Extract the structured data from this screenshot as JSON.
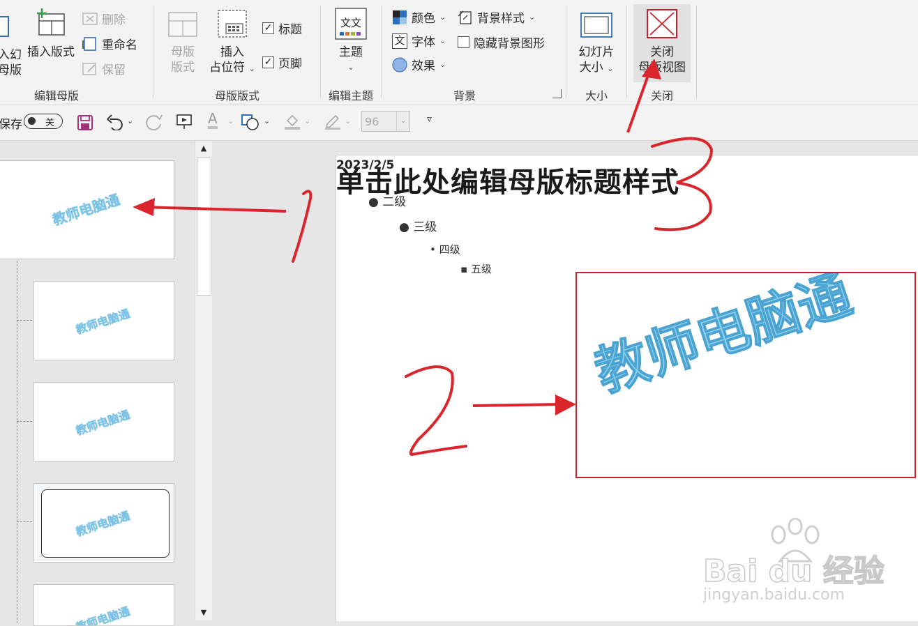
{
  "ribbon": {
    "edit_master": {
      "insert_slide_master_partial": [
        "入幻",
        "母版"
      ],
      "insert_layout": "插入版式",
      "delete": "删除",
      "rename": "重命名",
      "preserve": "保留",
      "group_label": "编辑母版"
    },
    "master_layout": {
      "master_layout_button": [
        "母版",
        "版式"
      ],
      "insert_placeholder": [
        "插入",
        "占位符"
      ],
      "title_checkbox": "标题",
      "footer_checkbox": "页脚",
      "group_label": "母版版式"
    },
    "edit_theme": {
      "themes": "主题",
      "theme_icon_text": "文文",
      "group_label": "编辑主题"
    },
    "background": {
      "colors": "颜色",
      "fonts": "字体",
      "font_icon_text": "文",
      "effects": "效果",
      "background_styles": "背景样式",
      "hide_background_graphics": "隐藏背景图形",
      "group_label": "背景"
    },
    "size": {
      "slide_size": [
        "幻灯片",
        "大小"
      ],
      "group_label": "大小"
    },
    "close": {
      "close_master_view": [
        "关闭",
        "母版视图"
      ],
      "group_label": "关闭"
    }
  },
  "qat": {
    "autosave_label": "保存",
    "autosave_state": "关",
    "font_size_value": "96"
  },
  "thumbnails": {
    "watermark": "教师电脑通"
  },
  "slide": {
    "date_overlap": "2023/2/5",
    "title": "单击此处编辑母版标题样式",
    "levels": [
      "二级",
      "三级",
      "四级",
      "五级"
    ],
    "watermark": "教师电脑通"
  },
  "annotations": {
    "numbers": [
      "1",
      "2",
      "3"
    ],
    "color": "#d9252b"
  },
  "branding": {
    "baidu_logo": "Bai du 经验",
    "baidu_url": "jingyan.baidu.com"
  },
  "colors": {
    "ribbon_bg": "#f3f3f3",
    "close_highlight": "#e1e1e1",
    "watermark_blue": "#7cc4e6",
    "highlight_box": "#c4212b"
  }
}
